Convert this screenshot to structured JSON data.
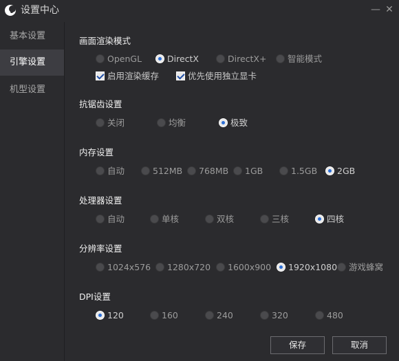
{
  "window": {
    "title": "设置中心",
    "icons": {
      "logo": "moon-logo-icon",
      "minimize": "minimize-icon",
      "close": "close-icon"
    }
  },
  "sidebar": {
    "items": [
      {
        "label": "基本设置",
        "active": false
      },
      {
        "label": "引擎设置",
        "active": true
      },
      {
        "label": "机型设置",
        "active": false
      }
    ]
  },
  "render_mode": {
    "title": "画面渲染模式",
    "options": [
      "OpenGL",
      "DirectX",
      "DirectX+",
      "智能模式"
    ],
    "selected": "DirectX",
    "checkboxes": [
      {
        "label": "启用渲染缓存",
        "checked": true
      },
      {
        "label": "优先使用独立显卡",
        "checked": true
      }
    ]
  },
  "antialias": {
    "title": "抗锯齿设置",
    "options": [
      "关闭",
      "均衡",
      "极致"
    ],
    "selected": "极致"
  },
  "memory": {
    "title": "内存设置",
    "options": [
      "自动",
      "512MB",
      "768MB",
      "1GB",
      "1.5GB",
      "2GB"
    ],
    "selected": "2GB"
  },
  "cpu": {
    "title": "处理器设置",
    "options": [
      "自动",
      "单核",
      "双核",
      "三核",
      "四核"
    ],
    "selected": "四核"
  },
  "resolution": {
    "title": "分辨率设置",
    "options": [
      "1024x576",
      "1280x720",
      "1600x900",
      "1920x1080",
      "游戏蜂窝"
    ],
    "selected": "1920x1080"
  },
  "dpi": {
    "title": "DPI设置",
    "options": [
      "120",
      "160",
      "240",
      "320",
      "480"
    ],
    "selected": "120"
  },
  "footer": {
    "save_label": "保存",
    "cancel_label": "取消"
  },
  "colors": {
    "background": "#2b2b2e",
    "active_sidebar": "#3d3d42",
    "radio_dot": "#2d6fd6"
  }
}
